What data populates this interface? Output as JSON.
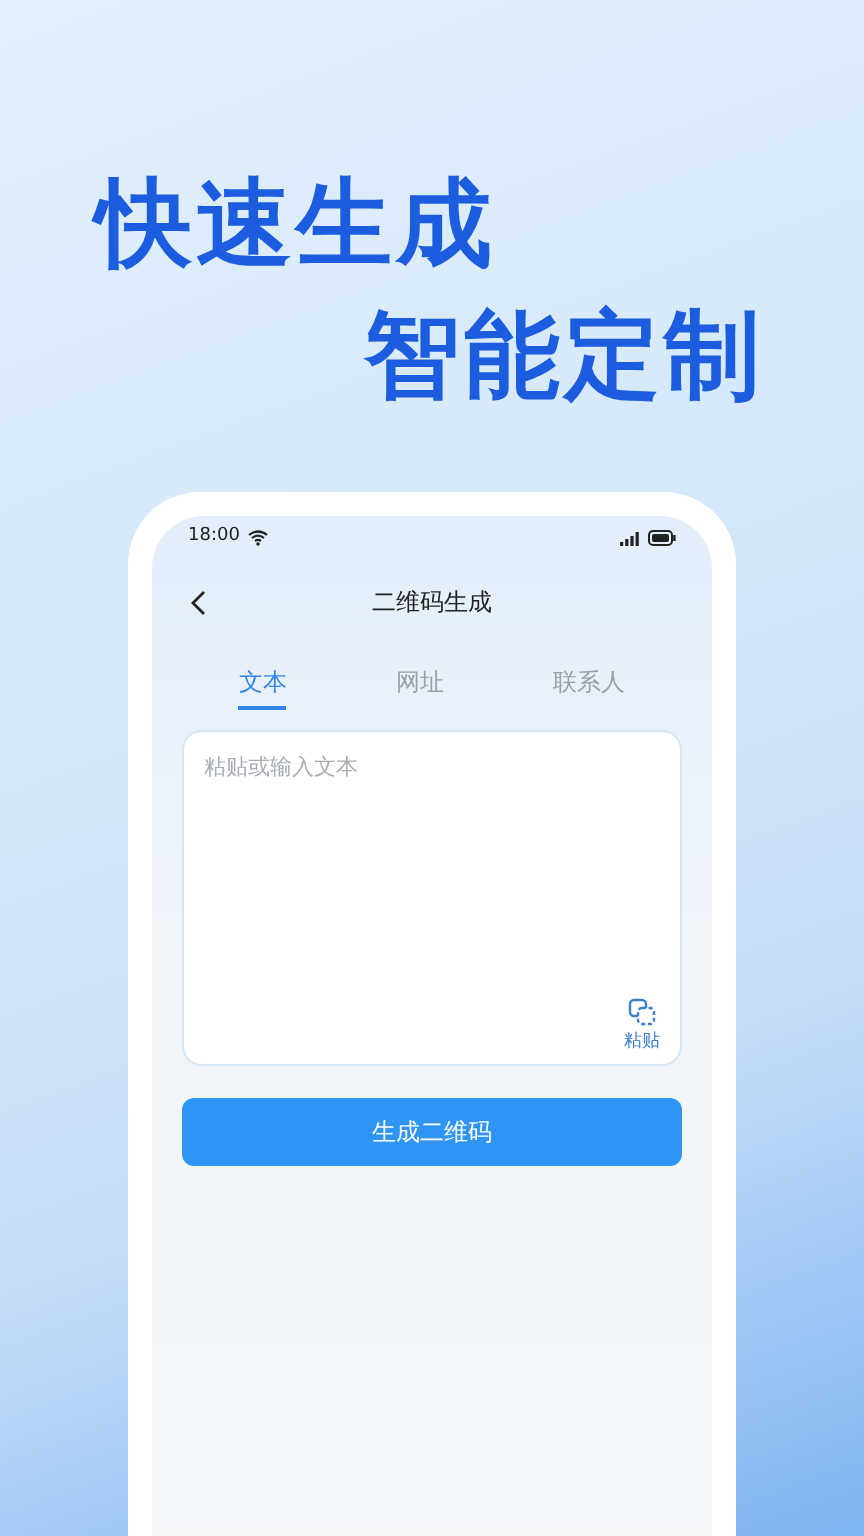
{
  "headline": [
    "快速生成",
    "智能定制"
  ],
  "status_bar": {
    "time": "18:00"
  },
  "nav": {
    "title": "二维码生成"
  },
  "tabs": [
    {
      "label": "文本",
      "selected": true
    },
    {
      "label": "网址",
      "selected": false
    },
    {
      "label": "联系人",
      "selected": false
    }
  ],
  "input": {
    "placeholder": "粘贴或输入文本",
    "paste_label": "粘贴"
  },
  "primary_button": "生成二维码"
}
